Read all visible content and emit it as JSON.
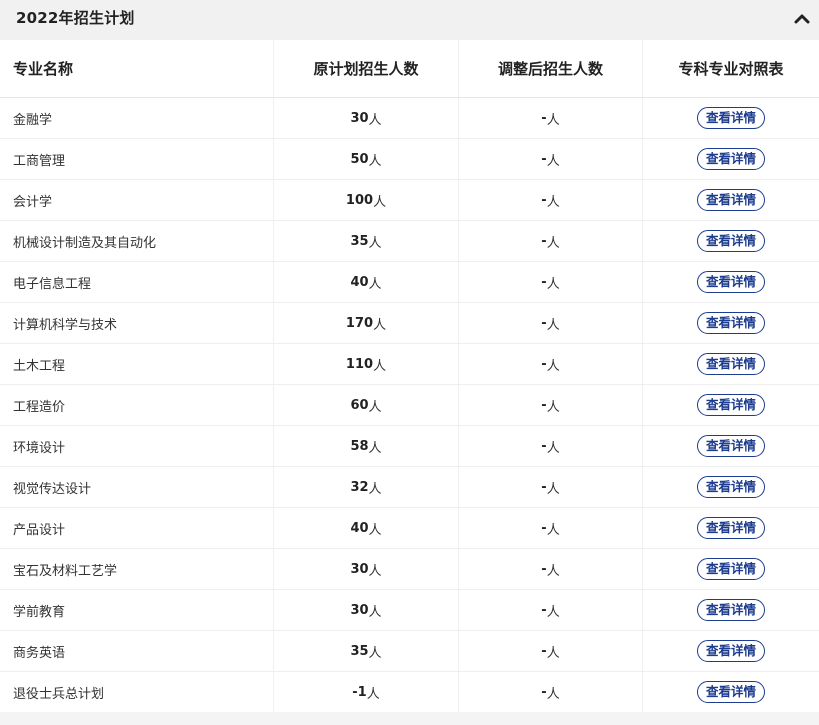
{
  "panel": {
    "title": "2022年招生计划",
    "collapse_icon": "chevron-up-icon"
  },
  "table": {
    "headers": [
      "专业名称",
      "原计划招生人数",
      "调整后招生人数",
      "专科专业对照表"
    ],
    "detail_label": "查看详情",
    "rows": [
      {
        "name": "金融学",
        "planned": "30",
        "unit": "人",
        "adjusted": "-",
        "adjusted_unit": "人"
      },
      {
        "name": "工商管理",
        "planned": "50",
        "unit": "人",
        "adjusted": "-",
        "adjusted_unit": "人"
      },
      {
        "name": "会计学",
        "planned": "100",
        "unit": "人",
        "adjusted": "-",
        "adjusted_unit": "人"
      },
      {
        "name": "机械设计制造及其自动化",
        "planned": "35",
        "unit": "人",
        "adjusted": "-",
        "adjusted_unit": "人"
      },
      {
        "name": "电子信息工程",
        "planned": "40",
        "unit": "人",
        "adjusted": "-",
        "adjusted_unit": "人"
      },
      {
        "name": "计算机科学与技术",
        "planned": "170",
        "unit": "人",
        "adjusted": "-",
        "adjusted_unit": "人"
      },
      {
        "name": "土木工程",
        "planned": "110",
        "unit": "人",
        "adjusted": "-",
        "adjusted_unit": "人"
      },
      {
        "name": "工程造价",
        "planned": "60",
        "unit": "人",
        "adjusted": "-",
        "adjusted_unit": "人"
      },
      {
        "name": "环境设计",
        "planned": "58",
        "unit": "人",
        "adjusted": "-",
        "adjusted_unit": "人"
      },
      {
        "name": "视觉传达设计",
        "planned": "32",
        "unit": "人",
        "adjusted": "-",
        "adjusted_unit": "人"
      },
      {
        "name": "产品设计",
        "planned": "40",
        "unit": "人",
        "adjusted": "-",
        "adjusted_unit": "人"
      },
      {
        "name": "宝石及材料工艺学",
        "planned": "30",
        "unit": "人",
        "adjusted": "-",
        "adjusted_unit": "人"
      },
      {
        "name": "学前教育",
        "planned": "30",
        "unit": "人",
        "adjusted": "-",
        "adjusted_unit": "人"
      },
      {
        "name": "商务英语",
        "planned": "35",
        "unit": "人",
        "adjusted": "-",
        "adjusted_unit": "人"
      },
      {
        "name": "退役士兵总计划",
        "planned": "-1",
        "unit": "人",
        "adjusted": "-",
        "adjusted_unit": "人"
      }
    ]
  },
  "colors": {
    "accent": "#1d3c8f",
    "header_bg": "#f1f1f1"
  }
}
